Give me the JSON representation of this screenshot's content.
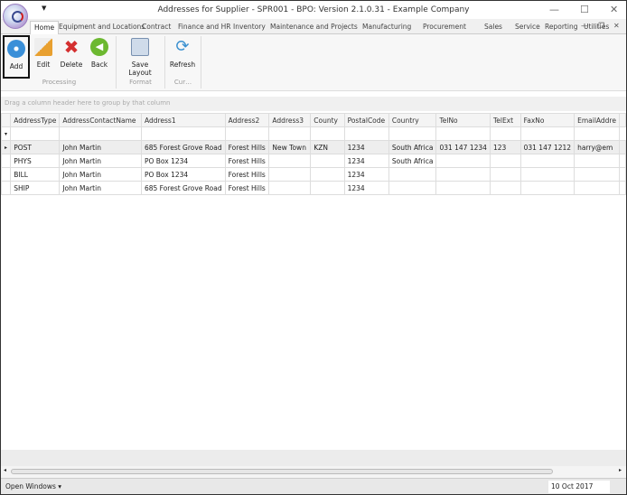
{
  "window": {
    "title": "Addresses for Supplier - SPR001 - BPO: Version 2.1.0.31 - Example Company"
  },
  "tabs": [
    "Home",
    "Equipment and Locations",
    "Contract",
    "Finance and HR",
    "Inventory",
    "Maintenance and Projects",
    "Manufacturing",
    "Procurement",
    "Sales",
    "Service",
    "Reporting",
    "Utilities"
  ],
  "ribbon": {
    "buttons": [
      {
        "label": "Add",
        "icon": "add-icon"
      },
      {
        "label": "Edit",
        "icon": "edit-icon"
      },
      {
        "label": "Delete",
        "icon": "delete-icon"
      },
      {
        "label": "Back",
        "icon": "back-icon"
      },
      {
        "label": "Save Layout",
        "icon": "save-layout-icon"
      },
      {
        "label": "Refresh",
        "icon": "refresh-icon"
      }
    ],
    "groups": [
      "Processing",
      "Format",
      "Cur…"
    ]
  },
  "grid": {
    "group_hint": "Drag a column header here to group by that column",
    "columns": [
      "AddressType",
      "AddressContactName",
      "Address1",
      "Address2",
      "Address3",
      "County",
      "PostalCode",
      "Country",
      "TelNo",
      "TelExt",
      "FaxNo",
      "EmailAddre"
    ],
    "rows": [
      [
        "POST",
        "John Martin",
        "685 Forest Grove Road",
        "Forest Hills",
        "New Town",
        "KZN",
        "1234",
        "South Africa",
        "031 147 1234",
        "123",
        "031 147 1212",
        "harry@em"
      ],
      [
        "PHYS",
        "John Martin",
        "PO Box 1234",
        "Forest Hills",
        "",
        "",
        "1234",
        "South Africa",
        "",
        "",
        "",
        ""
      ],
      [
        "BILL",
        "John Martin",
        "PO Box 1234",
        "Forest Hills",
        "",
        "",
        "1234",
        "",
        "",
        "",
        "",
        ""
      ],
      [
        "SHIP",
        "John Martin",
        "685 Forest Grove Road",
        "Forest Hills",
        "",
        "",
        "1234",
        "",
        "",
        "",
        "",
        ""
      ]
    ]
  },
  "status": {
    "open_windows": "Open Windows ▾",
    "date": "10 Oct 2017"
  }
}
